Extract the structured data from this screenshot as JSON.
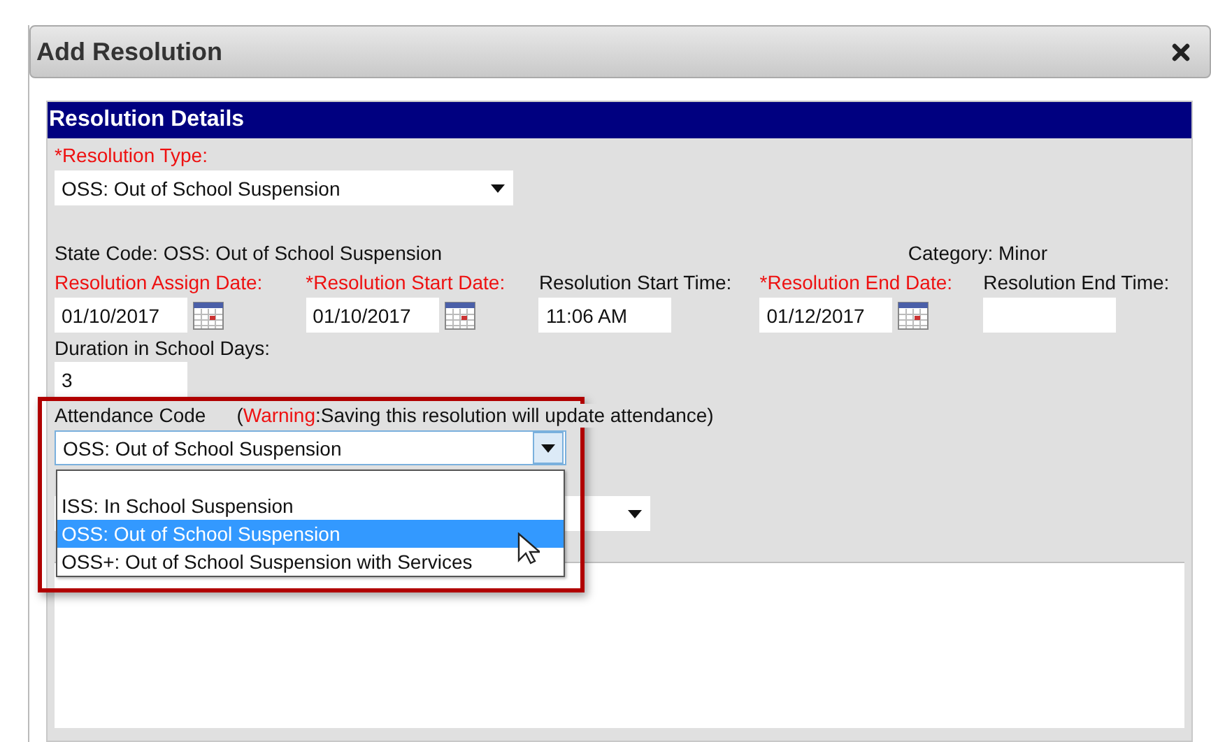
{
  "dialog": {
    "title": "Add Resolution"
  },
  "section": {
    "title": "Resolution Details"
  },
  "resolution_type": {
    "label": "*Resolution Type:",
    "value": "OSS: Out of School Suspension"
  },
  "state_code": "State Code: OSS: Out of School Suspension",
  "category": "Category: Minor",
  "date_fields": [
    {
      "kind": "date",
      "label": "Resolution Assign Date:",
      "required": true,
      "value": "01/10/2017"
    },
    {
      "kind": "date",
      "label": "*Resolution Start Date:",
      "required": true,
      "value": "01/10/2017"
    },
    {
      "kind": "time",
      "label": "Resolution Start Time:",
      "required": false,
      "value": "11:06 AM"
    },
    {
      "kind": "date",
      "label": "*Resolution End Date:",
      "required": true,
      "value": "01/12/2017"
    },
    {
      "kind": "time",
      "label": "Resolution End Time:",
      "required": false
    }
  ],
  "duration": {
    "label": "Duration in School Days:",
    "value": "3"
  },
  "attendance": {
    "label": "Attendance Code",
    "warning": {
      "prefix": "(",
      "keyword": "Warning",
      "text": ":Saving this resolution will update attendance)"
    },
    "value": "OSS: Out of School Suspension",
    "expanded": true,
    "options": [
      {
        "label": "ISS: In School Suspension",
        "selected": false
      },
      {
        "label": "OSS: Out of School Suspension",
        "selected": true
      },
      {
        "label": "OSS+: Out of School Suspension with Services",
        "selected": false
      }
    ]
  }
}
